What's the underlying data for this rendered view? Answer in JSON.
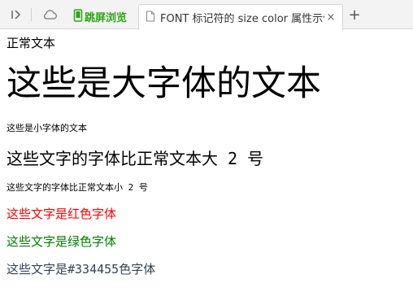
{
  "browser": {
    "special_tab": {
      "label": "跳屏浏览",
      "icon": "phone-icon",
      "color": "#2aa515"
    },
    "active_tab": {
      "title": "FONT 标记符的 size color 属性示例",
      "icon": "document-icon",
      "close_glyph": "×"
    },
    "new_tab_glyph": "+",
    "nav_icons": [
      "sidebar-toggle-icon",
      "cloud-icon"
    ]
  },
  "page": {
    "lines": [
      {
        "text": "正常文本",
        "color": "#000000"
      },
      {
        "text": "这些是大字体的文本",
        "color": "#000000"
      },
      {
        "text": "这些是小字体的文本",
        "color": "#000000"
      },
      {
        "text": "这些文字的字体比正常文本大 2 号",
        "color": "#000000"
      },
      {
        "text": "这些文字的字体比正常文本小 2 号",
        "color": "#000000"
      },
      {
        "text": "这些文字是红色字体",
        "color": "#ff0000"
      },
      {
        "text": "这些文字是绿色字体",
        "color": "#008000"
      },
      {
        "text": "这些文字是#334455色字体",
        "color": "#334455"
      }
    ]
  }
}
